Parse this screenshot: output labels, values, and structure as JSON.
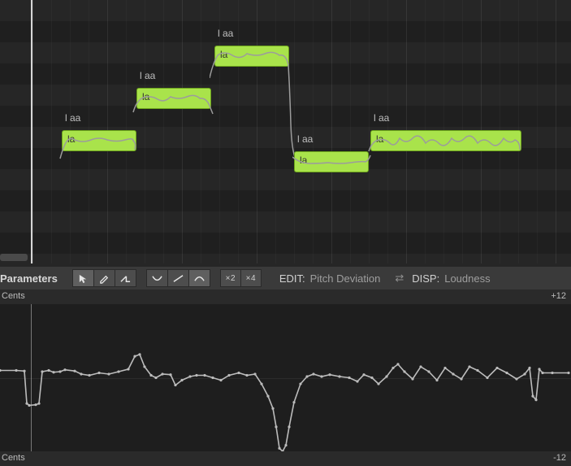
{
  "notes": [
    {
      "phoneme": "l aa",
      "lyric": "la",
      "left": 76,
      "width": 92,
      "rowTop": 160
    },
    {
      "phoneme": "l aa",
      "lyric": "la",
      "left": 168,
      "width": 92,
      "rowTop": 108
    },
    {
      "phoneme": "l aa",
      "lyric": "la",
      "left": 264,
      "width": 92,
      "rowTop": 56
    },
    {
      "phoneme": "l aa",
      "lyric": "la",
      "left": 362,
      "width": 92,
      "rowTop": 186
    },
    {
      "phoneme": "l aa",
      "lyric": "la",
      "left": 456,
      "width": 186,
      "rowTop": 160
    }
  ],
  "toolbar": {
    "title": "Parameters",
    "x2": "×2",
    "x4": "×4",
    "editLabel": "EDIT:",
    "editValue": "Pitch Deviation",
    "dispLabel": "DISP:",
    "dispValue": "Loudness"
  },
  "scale": {
    "unitTop": "Cents",
    "topVal": "+12",
    "unitBot": "Cents",
    "botVal": "-12"
  },
  "chart_data": {
    "type": "line",
    "title": "Pitch Deviation",
    "xlabel": "",
    "ylabel": "Cents",
    "ylim": [
      -12,
      12
    ],
    "x_range": [
      0,
      703
    ],
    "series": [
      {
        "name": "pitch",
        "x": [
          0,
          20,
          30,
          33,
          36,
          44,
          48,
          52,
          60,
          66,
          74,
          80,
          92,
          100,
          110,
          122,
          134,
          146,
          158,
          166,
          172,
          178,
          186,
          192,
          200,
          210,
          216,
          224,
          234,
          242,
          252,
          262,
          272,
          282,
          294,
          304,
          314,
          322,
          330,
          336,
          340,
          344,
          348,
          352,
          356,
          362,
          370,
          378,
          386,
          396,
          406,
          418,
          430,
          440,
          448,
          458,
          466,
          476,
          484,
          490,
          498,
          508,
          518,
          528,
          538,
          548,
          558,
          568,
          578,
          588,
          600,
          612,
          624,
          636,
          646,
          652,
          656,
          660,
          664,
          668,
          680,
          700
        ],
        "y": [
          1.2,
          1.2,
          1.1,
          -4.2,
          -4.5,
          -4.4,
          -4.2,
          1.0,
          1.2,
          0.9,
          1.0,
          1.3,
          1.1,
          0.6,
          0.4,
          0.8,
          0.6,
          1.0,
          1.4,
          3.5,
          3.8,
          1.8,
          0.4,
          0.0,
          0.6,
          0.5,
          -1.2,
          -0.4,
          0.2,
          0.4,
          0.4,
          0.0,
          -0.4,
          0.4,
          0.8,
          0.4,
          0.6,
          -1.0,
          -3.0,
          -5.0,
          -8.0,
          -11.5,
          -12.0,
          -11.0,
          -8.0,
          -4.0,
          -1.0,
          0.2,
          0.6,
          0.2,
          0.5,
          0.2,
          0.0,
          -0.6,
          0.5,
          0.0,
          -1.0,
          0.2,
          1.6,
          2.2,
          1.0,
          -0.2,
          1.8,
          1.0,
          -0.4,
          1.6,
          0.6,
          -0.2,
          1.8,
          1.2,
          0.0,
          1.6,
          0.8,
          -0.2,
          0.6,
          1.6,
          -3.0,
          -3.6,
          1.4,
          0.8,
          0.8,
          0.8
        ]
      }
    ]
  }
}
